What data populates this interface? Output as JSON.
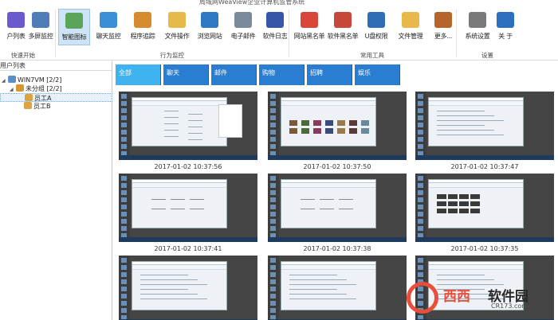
{
  "window": {
    "title": "局域网WeaView企业计算机监管系统"
  },
  "ribbon": {
    "groups": [
      {
        "label": "快速开始"
      },
      {
        "label": "行为监控"
      },
      {
        "label": "常用工具"
      },
      {
        "label": "设置"
      }
    ],
    "buttons": [
      {
        "label": "户列表",
        "icon": "user-list-icon",
        "color": "#6a5acd"
      },
      {
        "label": "多屏监控",
        "icon": "multi-screen-icon",
        "color": "#4f7db8"
      },
      {
        "label": "智能图标",
        "icon": "picture-icon",
        "color": "#5aa55a",
        "active": true
      },
      {
        "label": "聊天监控",
        "icon": "chat-monitor-icon",
        "color": "#3a8fd6"
      },
      {
        "label": "程序追踪",
        "icon": "program-track-icon",
        "color": "#d88a2e"
      },
      {
        "label": "文件操作",
        "icon": "file-operation-icon",
        "color": "#e5b94a"
      },
      {
        "label": "浏览网站",
        "icon": "compass-icon",
        "color": "#2e79c2"
      },
      {
        "label": "电子邮件",
        "icon": "email-icon",
        "color": "#7a8a9a"
      },
      {
        "label": "软件日志",
        "icon": "software-log-icon",
        "color": "#3856a8"
      },
      {
        "label": "网站黑名单",
        "icon": "web-blacklist-icon",
        "color": "#d9473b"
      },
      {
        "label": "软件黑名单",
        "icon": "software-blacklist-icon",
        "color": "#c8473b"
      },
      {
        "label": "U盘权限",
        "icon": "usb-icon",
        "color": "#2f6db5"
      },
      {
        "label": "文件管理",
        "icon": "folder-icon",
        "color": "#e8b84a"
      },
      {
        "label": "更多...",
        "icon": "briefcase-icon",
        "color": "#b5652a"
      },
      {
        "label": "系统设置",
        "icon": "gear-icon",
        "color": "#7a7a7a"
      },
      {
        "label": "关 于",
        "icon": "info-icon",
        "color": "#2c6fbe"
      }
    ]
  },
  "sidebar": {
    "header": "用户列表",
    "tree": [
      {
        "label": "WIN7VM  [2/2]",
        "level": 0,
        "icon": "computer-group-icon"
      },
      {
        "label": "未分组  [2/2]",
        "level": 1,
        "icon": "group-icon"
      },
      {
        "label": "员工A",
        "level": 2,
        "icon": "user-icon",
        "selected": true
      },
      {
        "label": "员工B",
        "level": 2,
        "icon": "user-icon"
      }
    ]
  },
  "main": {
    "tabs": [
      {
        "label": "全部",
        "active": true
      },
      {
        "label": "聊天"
      },
      {
        "label": "邮件"
      },
      {
        "label": "购物"
      },
      {
        "label": "招聘"
      },
      {
        "label": "娱乐"
      }
    ],
    "screenshots": [
      {
        "timestamp": "2017-01-02 10:37:56",
        "kind": "explorer"
      },
      {
        "timestamp": "2017-01-02 10:37:50",
        "kind": "images"
      },
      {
        "timestamp": "2017-01-02 10:37:47",
        "kind": "browser"
      },
      {
        "timestamp": "2017-01-02 10:37:41",
        "kind": "form"
      },
      {
        "timestamp": "2017-01-02 10:37:38",
        "kind": "form"
      },
      {
        "timestamp": "2017-01-02 10:37:35",
        "kind": "tiles"
      },
      {
        "timestamp": "",
        "kind": "browser"
      },
      {
        "timestamp": "",
        "kind": "browser"
      },
      {
        "timestamp": "",
        "kind": "browser"
      }
    ]
  },
  "watermark": {
    "brand_left": "西西",
    "brand_right": "软件园",
    "site": "CR173.com"
  }
}
